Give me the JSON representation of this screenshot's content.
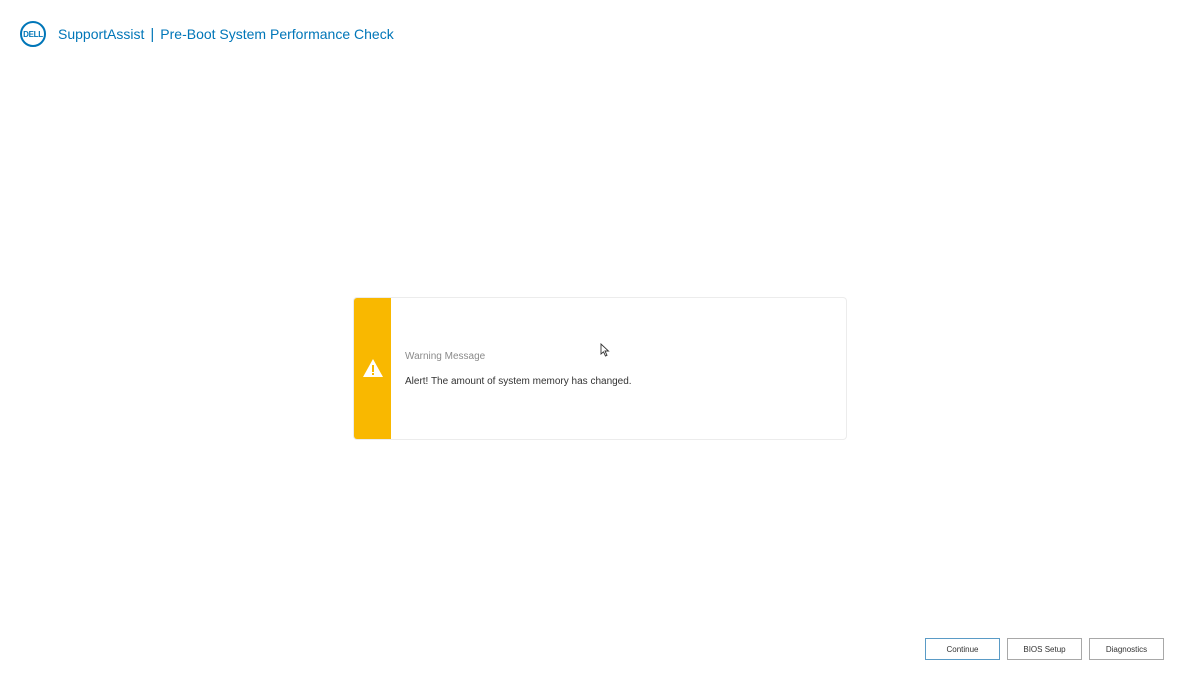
{
  "header": {
    "logo_text": "DELL",
    "app_name": "SupportAssist",
    "separator": "|",
    "subtitle": "Pre-Boot System Performance Check"
  },
  "warning_card": {
    "icon": "warning-triangle-icon",
    "title": "Warning Message",
    "message": "Alert! The amount of system memory has changed."
  },
  "footer": {
    "continue_label": "Continue",
    "bios_setup_label": "BIOS Setup",
    "diagnostics_label": "Diagnostics"
  },
  "colors": {
    "brand": "#0076b8",
    "warning": "#f9b800",
    "background": "#ffffff"
  }
}
